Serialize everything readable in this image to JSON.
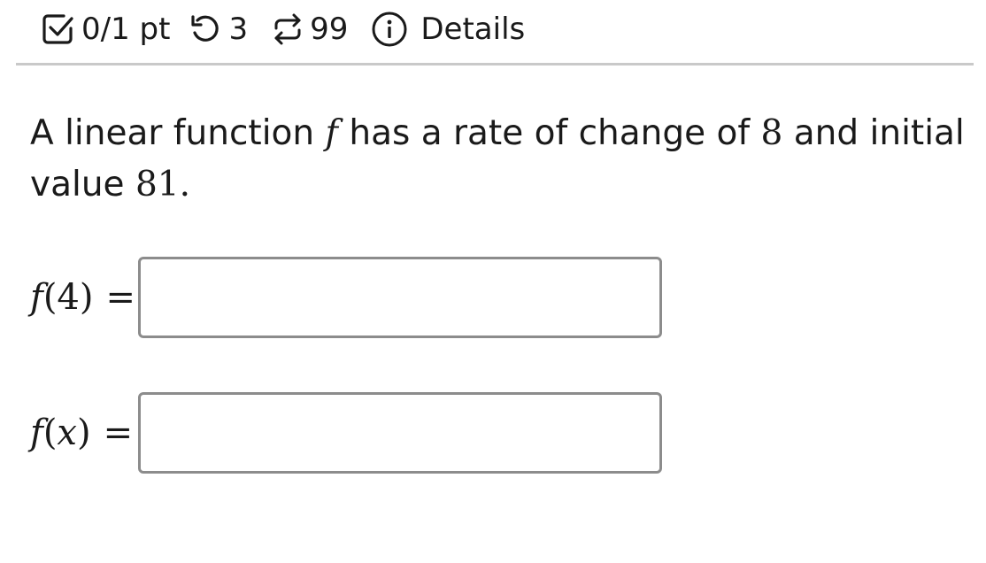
{
  "header": {
    "score_label": "0/1 pt",
    "tries_label": "3",
    "attempts_label": "99",
    "details_label": "Details"
  },
  "question": {
    "intro": "A linear function",
    "function_name": "f",
    "middle": "has a rate of change of",
    "rate_of_change": "8",
    "and_initial": "and initial",
    "value_word": "value",
    "initial_value": "81",
    "period": "."
  },
  "answers": [
    {
      "fn": "f",
      "argument": "(4)",
      "equals": "=",
      "value": ""
    },
    {
      "fn": "f",
      "argument_open": "(",
      "argument_var": "x",
      "argument_close": ")",
      "equals": "=",
      "value": ""
    }
  ],
  "icons": {
    "score": "check-square-icon",
    "tries": "retry-icon",
    "attempts": "repeat-arrows-icon",
    "details": "info-circle-icon"
  }
}
